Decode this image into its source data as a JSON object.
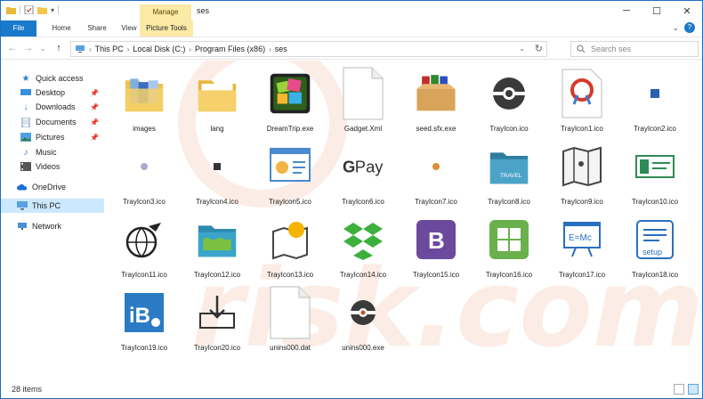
{
  "window": {
    "title": "ses",
    "manage_label": "Manage",
    "controls": {
      "minimize": "─",
      "maximize": "☐",
      "close": "✕"
    }
  },
  "ribbon": {
    "tabs": [
      "File",
      "Home",
      "Share",
      "View"
    ],
    "picture_tools": "Picture Tools",
    "help_glyph": "?",
    "expand_glyph": "⌄"
  },
  "nav": {
    "back": "←",
    "forward": "→",
    "dropdown": "⌄",
    "up": "↑",
    "breadcrumbs": [
      "This PC",
      "Local Disk (C:)",
      "Program Files (x86)",
      "ses"
    ],
    "refresh": "↻",
    "search_placeholder": "Search ses"
  },
  "sidebar": {
    "items": [
      {
        "label": "Quick access",
        "icon": "star-icon"
      },
      {
        "label": "Desktop",
        "icon": "desktop-icon",
        "pinned": true
      },
      {
        "label": "Downloads",
        "icon": "downloads-icon",
        "pinned": true
      },
      {
        "label": "Documents",
        "icon": "documents-icon",
        "pinned": true
      },
      {
        "label": "Pictures",
        "icon": "pictures-icon",
        "pinned": true
      },
      {
        "label": "Music",
        "icon": "music-icon"
      },
      {
        "label": "Videos",
        "icon": "videos-icon"
      },
      {
        "label": "OneDrive",
        "icon": "cloud-icon"
      },
      {
        "label": "This PC",
        "icon": "computer-icon",
        "selected": true
      },
      {
        "label": "Network",
        "icon": "network-icon"
      }
    ]
  },
  "files": [
    {
      "name": "images",
      "kind": "folder-books"
    },
    {
      "name": "lang",
      "kind": "folder"
    },
    {
      "name": "DreamTrip.exe",
      "kind": "dreamtrip"
    },
    {
      "name": "Gadget.Xml",
      "kind": "blank"
    },
    {
      "name": "seed.sfx.exe",
      "kind": "box"
    },
    {
      "name": "TrayIcon.ico",
      "kind": "disc"
    },
    {
      "name": "TrayIcon1.ico",
      "kind": "clip"
    },
    {
      "name": "TrayIcon2.ico",
      "kind": "tiny-blue"
    },
    {
      "name": "TrayIcon3.ico",
      "kind": "tiny-gray"
    },
    {
      "name": "TrayIcon4.ico",
      "kind": "tiny-dark"
    },
    {
      "name": "TrayIcon5.ico",
      "kind": "chart"
    },
    {
      "name": "TrayIcon6.ico",
      "kind": "gpay"
    },
    {
      "name": "TrayIcon7.ico",
      "kind": "tiny-orange"
    },
    {
      "name": "TrayIcon8.ico",
      "kind": "travel"
    },
    {
      "name": "TrayIcon9.ico",
      "kind": "map"
    },
    {
      "name": "TrayIcon10.ico",
      "kind": "tickets"
    },
    {
      "name": "TrayIcon11.ico",
      "kind": "globe"
    },
    {
      "name": "TrayIcon12.ico",
      "kind": "worldfolder"
    },
    {
      "name": "TrayIcon13.ico",
      "kind": "mappin"
    },
    {
      "name": "TrayIcon14.ico",
      "kind": "dropbox"
    },
    {
      "name": "TrayIcon15.ico",
      "kind": "bootstrap"
    },
    {
      "name": "TrayIcon16.ico",
      "kind": "windows"
    },
    {
      "name": "TrayIcon17.ico",
      "kind": "emc"
    },
    {
      "name": "TrayIcon18.ico",
      "kind": "setup"
    },
    {
      "name": "TrayIcon19.ico",
      "kind": "ib"
    },
    {
      "name": "TrayIcon20.ico",
      "kind": "download"
    },
    {
      "name": "unins000.dat",
      "kind": "blank"
    },
    {
      "name": "unins000.exe",
      "kind": "disc-small"
    }
  ],
  "status": {
    "count": "28 items"
  },
  "colors": {
    "accent": "#1979ca",
    "selection": "#cce8ff",
    "manage": "#fbe9a6"
  }
}
